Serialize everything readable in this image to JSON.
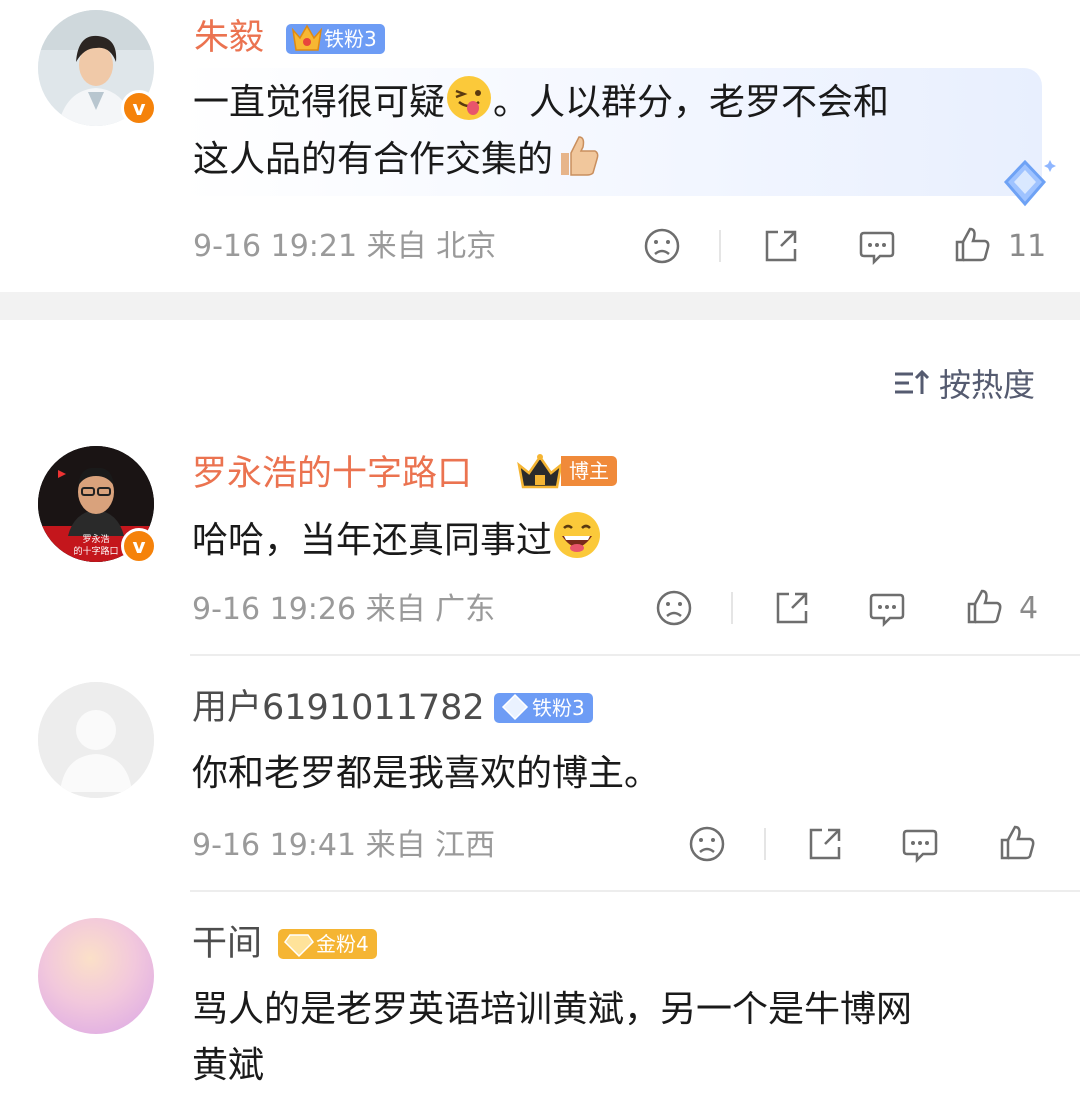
{
  "top_comment": {
    "name": "朱毅",
    "badge": "铁粉3",
    "text_line1_a": "一直觉得很可疑",
    "text_line1_b": "。人以群分，老罗不会和",
    "text_line2": "这人品的有合作交集的",
    "meta": "9-16 19:21  来自 北京",
    "like_count": "11"
  },
  "sort": {
    "label": "按热度",
    "icon": "sort-icon"
  },
  "comments": [
    {
      "name": "罗永浩的十字路口",
      "badge": "博主",
      "avatar_caption_1": "罗永浩",
      "avatar_caption_2": "的十字路口",
      "text": "哈哈，当年还真同事过",
      "meta": "9-16 19:26  来自 广东",
      "like_count": "4"
    },
    {
      "name": "用户6191011782",
      "badge": "铁粉3",
      "text": "你和老罗都是我喜欢的博主。",
      "meta": "9-16 19:41  来自 江西",
      "like_count": ""
    },
    {
      "name": "干间",
      "badge": "金粉4",
      "text_line1": "骂人的是老罗英语培训黄斌，另一个是牛博网",
      "text_line2": "黄斌"
    }
  ],
  "colors": {
    "name_orange": "#eb7350",
    "badge_blue": "#5b8ff9",
    "badge_gold": "#f5b533",
    "verified": "#f5820a"
  }
}
